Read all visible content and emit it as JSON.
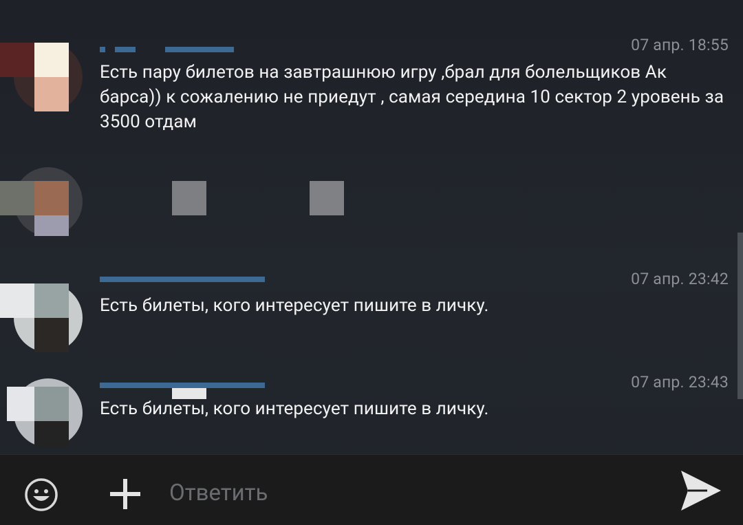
{
  "messages": [
    {
      "time": "07 апр. 18:55",
      "text": "Есть пару билетов на завтрашнюю игру ,брал для болельщиков Ак барса)) к сожалению не приедут , самая середина 10 сектор 2 уровень за 3500 отдам"
    },
    {
      "time": "",
      "text": ""
    },
    {
      "time": "07 апр. 23:42",
      "text": "Есть билеты, кого интересует пишите в личку."
    },
    {
      "time": "07 апр. 23:43",
      "text": "Есть билеты, кого интересует пишите в личку."
    }
  ],
  "composer": {
    "placeholder": "Ответить",
    "emoji_icon": "emoji-icon",
    "attach_icon": "plus-icon",
    "send_icon": "send-icon"
  },
  "colors": {
    "background": "#20242a",
    "bottom_bar": "#1b1b1b",
    "message_text": "#f2f2f2",
    "time_text": "#8c9096",
    "placeholder_text": "#6a6c70",
    "icons": "#d8d8d8"
  }
}
